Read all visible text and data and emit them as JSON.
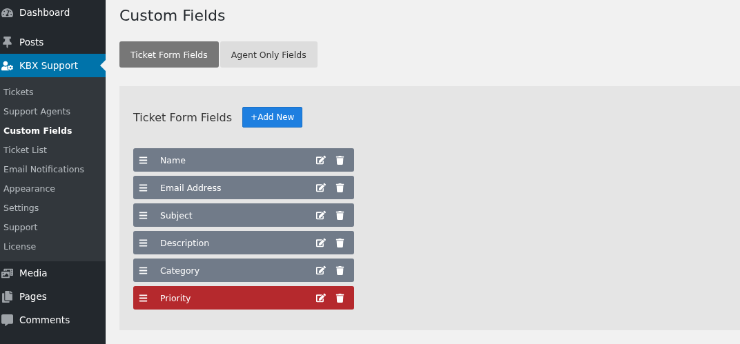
{
  "sidebar": {
    "items": [
      {
        "label": "Dashboard",
        "selected": false
      },
      {
        "label": "Posts",
        "selected": false
      },
      {
        "label": "KBX Support",
        "selected": true,
        "children": [
          {
            "label": "Tickets",
            "selected": false
          },
          {
            "label": "Support Agents",
            "selected": false
          },
          {
            "label": "Custom Fields",
            "selected": true
          },
          {
            "label": "Ticket List",
            "selected": false
          },
          {
            "label": "Email Notifications",
            "selected": false
          },
          {
            "label": "Appearance",
            "selected": false
          },
          {
            "label": "Settings",
            "selected": false
          },
          {
            "label": "Support",
            "selected": false
          },
          {
            "label": "License",
            "selected": false
          }
        ]
      },
      {
        "label": "Media",
        "selected": false
      },
      {
        "label": "Pages",
        "selected": false
      },
      {
        "label": "Comments",
        "selected": false
      }
    ]
  },
  "page_title": "Custom Fields",
  "tabs": [
    {
      "label": "Ticket Form Fields",
      "selected": true
    },
    {
      "label": "Agent Only Fields",
      "selected": false
    }
  ],
  "panel": {
    "title": "Ticket Form Fields",
    "add_button": "+Add New",
    "fields": [
      {
        "label": "Name",
        "selected": false
      },
      {
        "label": "Email Address",
        "selected": false
      },
      {
        "label": "Subject",
        "selected": false
      },
      {
        "label": "Description",
        "selected": false
      },
      {
        "label": "Category",
        "selected": false
      },
      {
        "label": "Priority",
        "selected": true
      }
    ]
  }
}
